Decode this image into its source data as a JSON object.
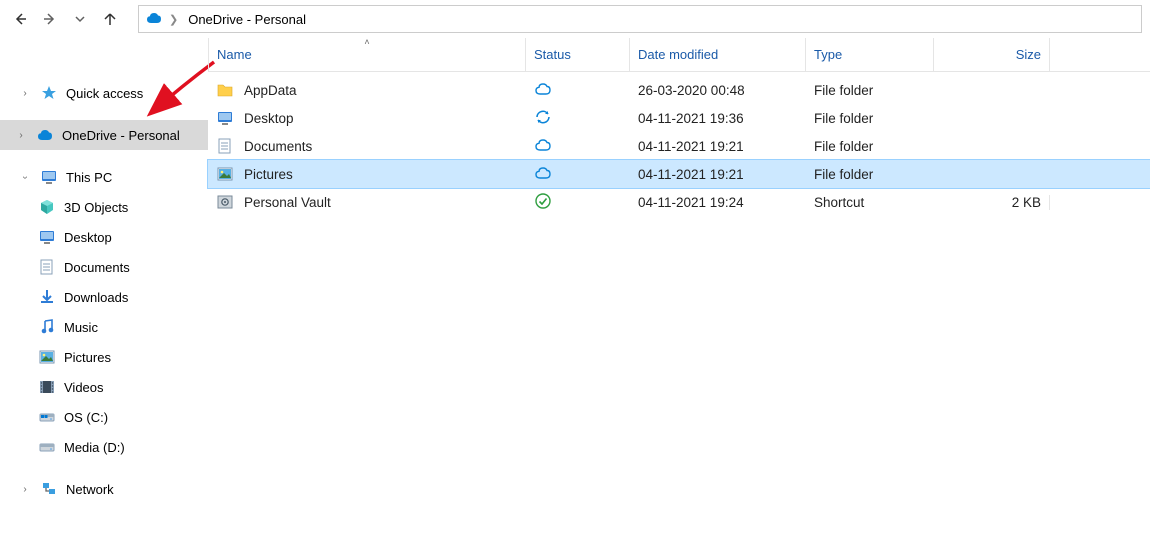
{
  "breadcrumb": {
    "current": "OneDrive - Personal"
  },
  "columns": {
    "name": "Name",
    "status": "Status",
    "date": "Date modified",
    "type": "Type",
    "size": "Size"
  },
  "sidebar": {
    "quick_access": "Quick access",
    "onedrive": "OneDrive - Personal",
    "this_pc": "This PC",
    "this_pc_children": [
      {
        "label": "3D Objects"
      },
      {
        "label": "Desktop"
      },
      {
        "label": "Documents"
      },
      {
        "label": "Downloads"
      },
      {
        "label": "Music"
      },
      {
        "label": "Pictures"
      },
      {
        "label": "Videos"
      },
      {
        "label": "OS (C:)"
      },
      {
        "label": "Media (D:)"
      }
    ],
    "network": "Network"
  },
  "rows": [
    {
      "name": "AppData",
      "status": "cloud",
      "date": "26-03-2020 00:48",
      "type": "File folder",
      "size": ""
    },
    {
      "name": "Desktop",
      "status": "sync",
      "date": "04-11-2021 19:36",
      "type": "File folder",
      "size": ""
    },
    {
      "name": "Documents",
      "status": "cloud",
      "date": "04-11-2021 19:21",
      "type": "File folder",
      "size": ""
    },
    {
      "name": "Pictures",
      "status": "cloud",
      "date": "04-11-2021 19:21",
      "type": "File folder",
      "size": "",
      "selected": true
    },
    {
      "name": "Personal Vault",
      "status": "check",
      "date": "04-11-2021 19:24",
      "type": "Shortcut",
      "size": "2 KB"
    }
  ]
}
